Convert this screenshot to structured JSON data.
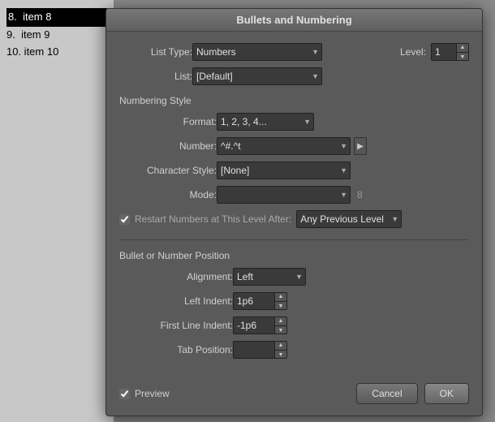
{
  "dialog": {
    "title": "Bullets and Numbering",
    "list_type_label": "List Type:",
    "list_type_value": "Numbers",
    "list_label": "List:",
    "list_value": "[Default]",
    "level_label": "Level:",
    "level_value": "1",
    "numbering_style_title": "Numbering Style",
    "format_label": "Format:",
    "format_value": "1, 2, 3, 4...",
    "number_label": "Number:",
    "number_value": "^#.^t",
    "character_style_label": "Character Style:",
    "character_style_value": "[None]",
    "mode_label": "Mode:",
    "mode_value": "",
    "mode_number": "8",
    "restart_checkbox_checked": true,
    "restart_label": "Restart Numbers at This Level After:",
    "restart_after_value": "Any Previous Level",
    "position_title": "Bullet or Number Position",
    "alignment_label": "Alignment:",
    "alignment_value": "Left",
    "left_indent_label": "Left Indent:",
    "left_indent_value": "1p6",
    "first_line_indent_label": "First Line Indent:",
    "first_line_indent_value": "-1p6",
    "tab_position_label": "Tab Position:",
    "tab_position_value": "",
    "preview_checked": true,
    "preview_label": "Preview",
    "cancel_label": "Cancel",
    "ok_label": "OK"
  },
  "doc": {
    "items": [
      {
        "number": "8.",
        "text": "item 8",
        "selected": true
      },
      {
        "number": "9.",
        "text": "item 9",
        "selected": false
      },
      {
        "number": "10.",
        "text": "item 10",
        "selected": false
      }
    ]
  },
  "icons": {
    "up_arrow": "▲",
    "down_arrow": "▼",
    "right_arrow": "▶",
    "dropdown_arrow": "▼"
  }
}
